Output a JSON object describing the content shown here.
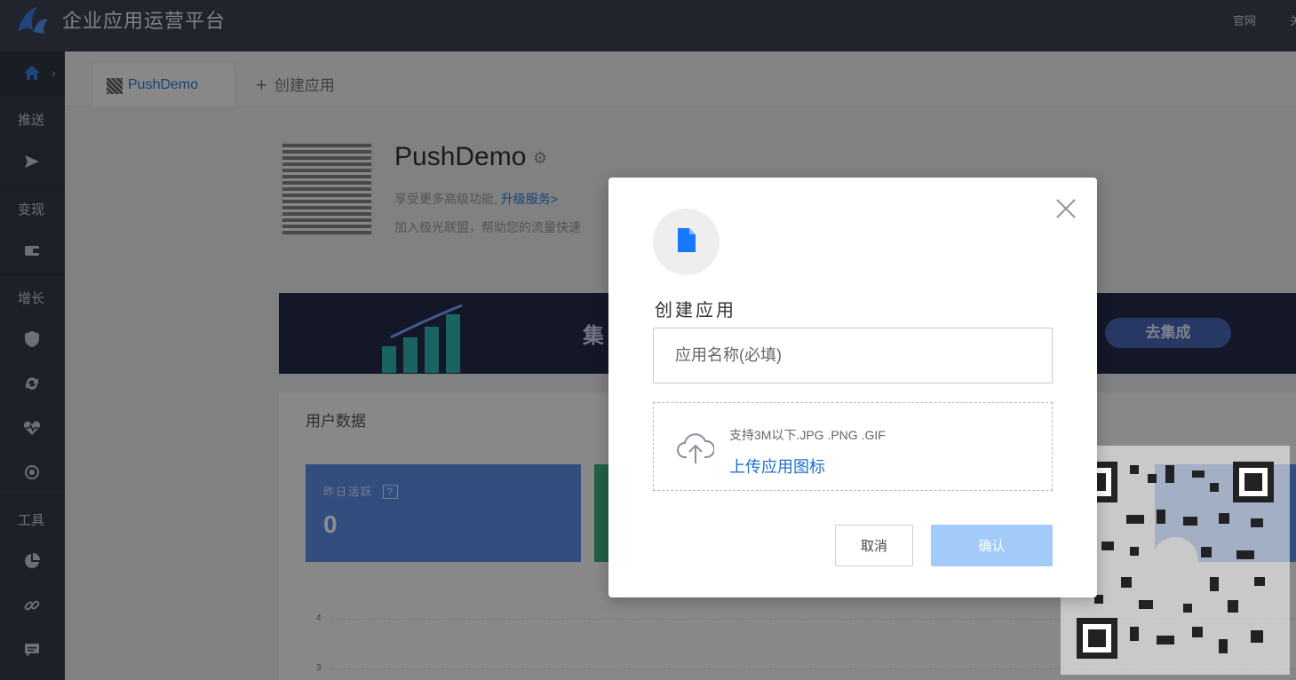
{
  "header": {
    "title": "企业应用运营平台",
    "links": [
      "官网",
      "关"
    ]
  },
  "sidebar": {
    "sections": [
      "推送",
      "变现",
      "增长",
      "工具"
    ]
  },
  "tabs": {
    "active_label": "PushDemo",
    "create_label": "创建应用"
  },
  "app": {
    "name": "PushDemo",
    "line1_prefix": "享受更多高级功能,",
    "line1_link": "升级服务>",
    "line2": "加入极光联盟，帮助您的流量快速"
  },
  "banner": {
    "title_fragment": "集",
    "button": "去集成"
  },
  "data": {
    "title": "用户数据",
    "card_label": "昨日活跃",
    "card_help": "?",
    "card_value": "0",
    "axis_ticks": [
      "4",
      "3"
    ]
  },
  "modal": {
    "title": "创建应用",
    "name_placeholder": "应用名称(必填)",
    "upload_hint": "支持3M以下.JPG .PNG .GIF",
    "upload_link": "上传应用图标",
    "cancel": "取消",
    "confirm": "确认"
  },
  "colors": {
    "accent": "#1f6fd0",
    "confirm_disabled": "#a3cbfa",
    "topbar": "#3d4352",
    "sidebar": "#353b48"
  }
}
